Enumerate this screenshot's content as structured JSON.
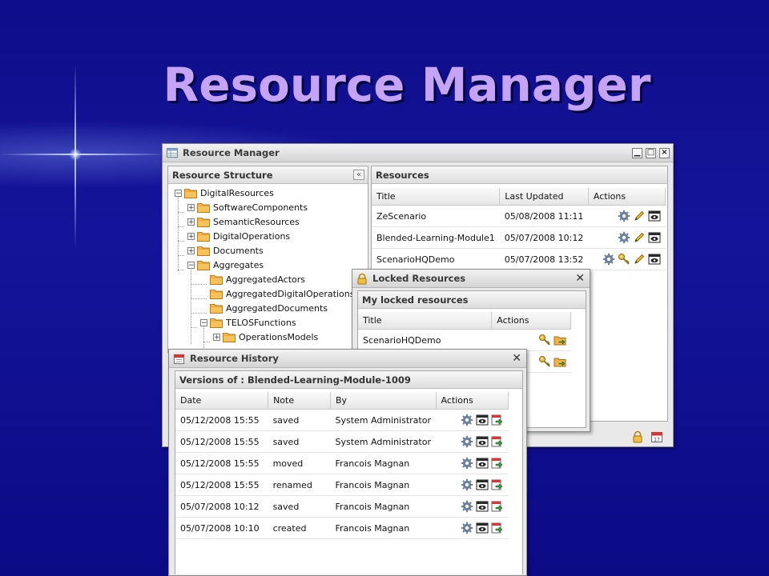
{
  "slide_title": "Resource Manager",
  "main_window": {
    "title": "Resource Manager",
    "structure_panel": {
      "title": "Resource Structure",
      "collapse_glyph": "«",
      "tree": [
        {
          "label": "DigitalResources",
          "toggle": "−"
        },
        {
          "label": "SoftwareComponents",
          "toggle": "+"
        },
        {
          "label": "SemanticResources",
          "toggle": "+"
        },
        {
          "label": "DigitalOperations",
          "toggle": "+"
        },
        {
          "label": "Documents",
          "toggle": "+"
        },
        {
          "label": "Aggregates",
          "toggle": "−"
        },
        {
          "label": "AggregatedActors",
          "toggle": ""
        },
        {
          "label": "AggregatedDigitalOperations",
          "toggle": ""
        },
        {
          "label": "AggregatedDocuments",
          "toggle": ""
        },
        {
          "label": "TELOSFunctions",
          "toggle": "−"
        },
        {
          "label": "OperationsModels",
          "toggle": "+"
        }
      ]
    },
    "resources_panel": {
      "title": "Resources",
      "columns": [
        "Title",
        "Last Updated",
        "Actions"
      ],
      "rows": [
        {
          "title": "ZeScenario",
          "updated": "05/08/2008 11:11",
          "actions": [
            "gear-icon",
            "pencil-icon",
            "view-icon"
          ]
        },
        {
          "title": "Blended-Learning-Module1",
          "updated": "05/07/2008 10:12",
          "actions": [
            "gear-icon",
            "pencil-icon",
            "view-icon"
          ]
        },
        {
          "title": "ScenarioHQDemo",
          "updated": "05/07/2008 13:52",
          "actions": [
            "gear-icon",
            "key-icon",
            "pencil-icon",
            "view-icon"
          ]
        }
      ]
    },
    "footer_icons": [
      "lock-icon",
      "calendar-icon"
    ]
  },
  "locked_window": {
    "title": "Locked Resources",
    "panel_title": "My locked resources",
    "columns": [
      "Title",
      "Actions"
    ],
    "rows": [
      {
        "title": "ScenarioHQDemo",
        "actions": [
          "key-icon",
          "folder-arrow-icon"
        ]
      },
      {
        "title": "",
        "actions": [
          "key-icon",
          "folder-arrow-icon"
        ]
      }
    ]
  },
  "history_window": {
    "title": "Resource History",
    "panel_title": "Versions of : Blended-Learning-Module-1009",
    "columns": [
      "Date",
      "Note",
      "By",
      "Actions"
    ],
    "rows": [
      {
        "date": "05/12/2008 15:55",
        "note": "saved",
        "by": "System Administrator"
      },
      {
        "date": "05/12/2008 15:55",
        "note": "saved",
        "by": "System Administrator"
      },
      {
        "date": "05/12/2008 15:55",
        "note": "moved",
        "by": "Francois Magnan"
      },
      {
        "date": "05/12/2008 15:55",
        "note": "renamed",
        "by": "Francois Magnan"
      },
      {
        "date": "05/07/2008 10:12",
        "note": "saved",
        "by": "Francois Magnan"
      },
      {
        "date": "05/07/2008 10:10",
        "note": "created",
        "by": "Francois Magnan"
      }
    ],
    "row_actions": [
      "gear-icon",
      "view-icon",
      "export-icon"
    ]
  },
  "colors": {
    "slide_background": "#0f0f8c",
    "title_text": "#c6a4f5",
    "folder": "#f2a93b"
  }
}
